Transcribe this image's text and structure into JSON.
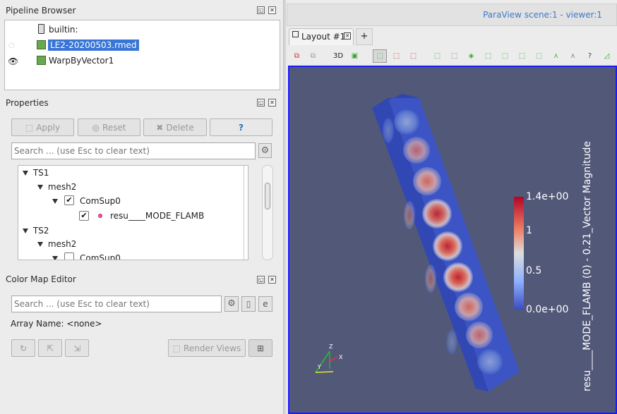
{
  "pipeline": {
    "title": "Pipeline Browser",
    "items": [
      {
        "label": "builtin:"
      },
      {
        "label": "LE2-20200503.rmed"
      },
      {
        "label": "WarpByVector1"
      }
    ]
  },
  "properties": {
    "title": "Properties",
    "apply": "Apply",
    "reset": "Reset",
    "delete": "Delete",
    "help": "?",
    "search_placeholder": "Search ... (use Esc to clear text)",
    "tree": [
      {
        "label": "TS1"
      },
      {
        "label": "mesh2"
      },
      {
        "label": "ComSup0"
      },
      {
        "label": "resu____MODE_FLAMB"
      },
      {
        "label": "TS2"
      },
      {
        "label": "mesh2"
      },
      {
        "label": "ComSup0"
      }
    ]
  },
  "colormap": {
    "title": "Color Map Editor",
    "search_placeholder": "Search ... (use Esc to clear text)",
    "array_name": "Array Name: <none>",
    "render_views": "Render Views"
  },
  "viewer": {
    "scene_title": "ParaView scene:1 - viewer:1",
    "tab_label": "Layout #1",
    "toolbar_3d": "3D",
    "legend_title": "resu____MODE_FLAMB (0) - 0.21_Vector Magnitude",
    "legend_ticks": [
      "1.4e+00",
      "1",
      "0.5",
      "0.0e+00"
    ],
    "axes": {
      "z": "Z",
      "x": "X",
      "y": "Y"
    },
    "colors": {
      "background": "#525878",
      "low": "#3b4cc0",
      "mid": "#dddddd",
      "high": "#b40426",
      "border": "#1a1aff",
      "accent": "#3c7ac8"
    }
  }
}
